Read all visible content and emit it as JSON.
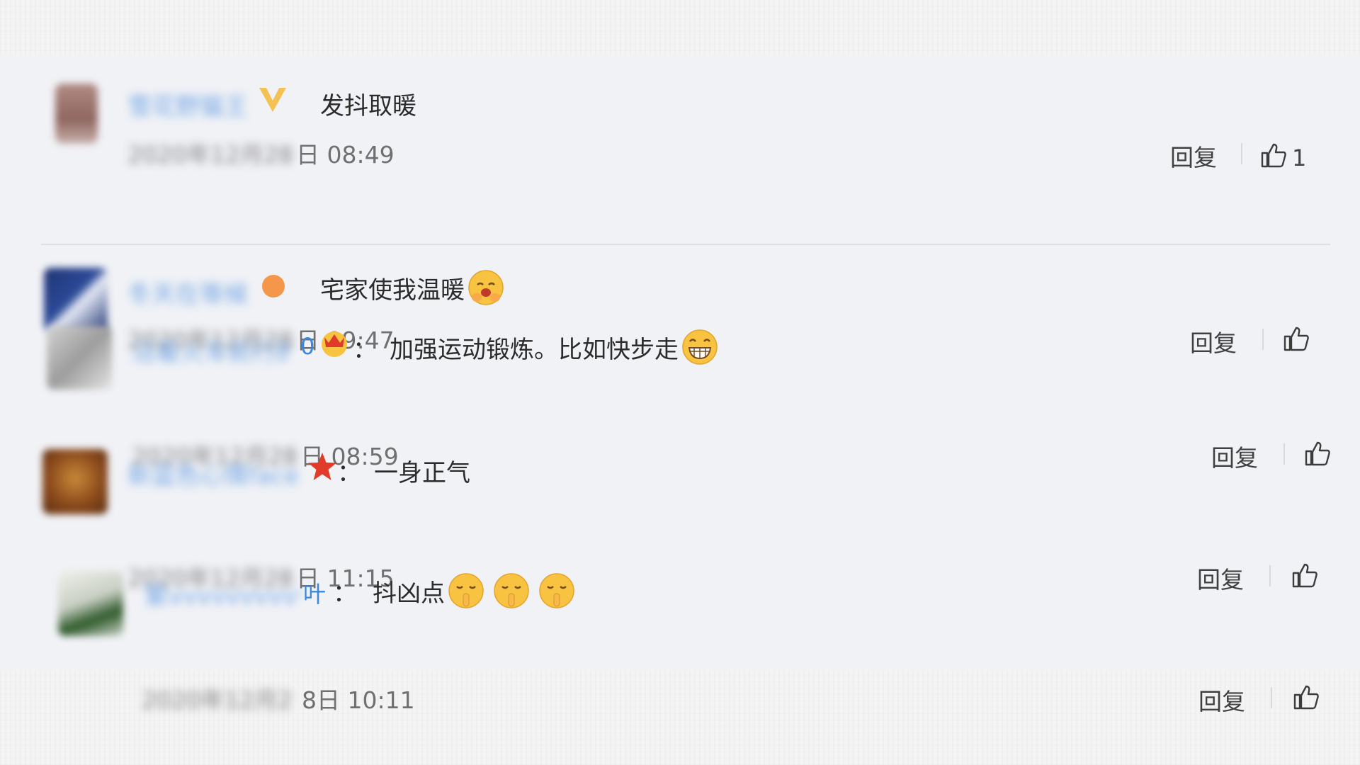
{
  "comments": [
    {
      "name_blurred": "雪花野猫王",
      "name_tail": "",
      "text": "发抖取暖",
      "date_blurred": "2020年12月28",
      "date_visible": "日 08:49",
      "reply": "回复",
      "likes": "1",
      "badge": "v-badge"
    },
    {
      "name_blurred": "冬天在等候",
      "name_tail": "",
      "text": "宅家使我温暖",
      "date_blurred": "2020年12月28",
      "date_visible": "日 09:47",
      "reply": "回复",
      "likes": "",
      "badge": "sun-badge",
      "emoji": "hug-emoji"
    },
    {
      "name_blurred": "沿着火车前行的10",
      "name_tail": "0",
      "separator": "：",
      "text": "加强运动锻炼。比如快步走",
      "date_blurred": "2020年12月28",
      "date_visible": "日 08:59",
      "reply": "回复",
      "likes": "",
      "badge": "crown-badge",
      "emoji": "grin-emoji"
    },
    {
      "name_blurred": "新蓝色心情face",
      "name_tail": "",
      "separator": "：",
      "text": "一身正气",
      "date_blurred": "2020年12月28",
      "date_visible": "日 11:15",
      "reply": "回复",
      "likes": "",
      "badge": "star-badge"
    },
    {
      "name_blurred": "繁vvvvvvvvvv",
      "name_tail": "叶",
      "separator": "：",
      "text": "抖凶点",
      "date_blurred": "2020年12月2",
      "date_visible": "8日 10:11",
      "reply": "回复",
      "likes": "",
      "emoji": "shush-emoji"
    }
  ],
  "colors": {
    "name_link": "#3b87e0",
    "text": "#2b2b2b",
    "meta": "#707070",
    "panel_bg": "#f1f2f6",
    "star": "#e23b2a",
    "emoji_yellow": "#f7c340"
  }
}
